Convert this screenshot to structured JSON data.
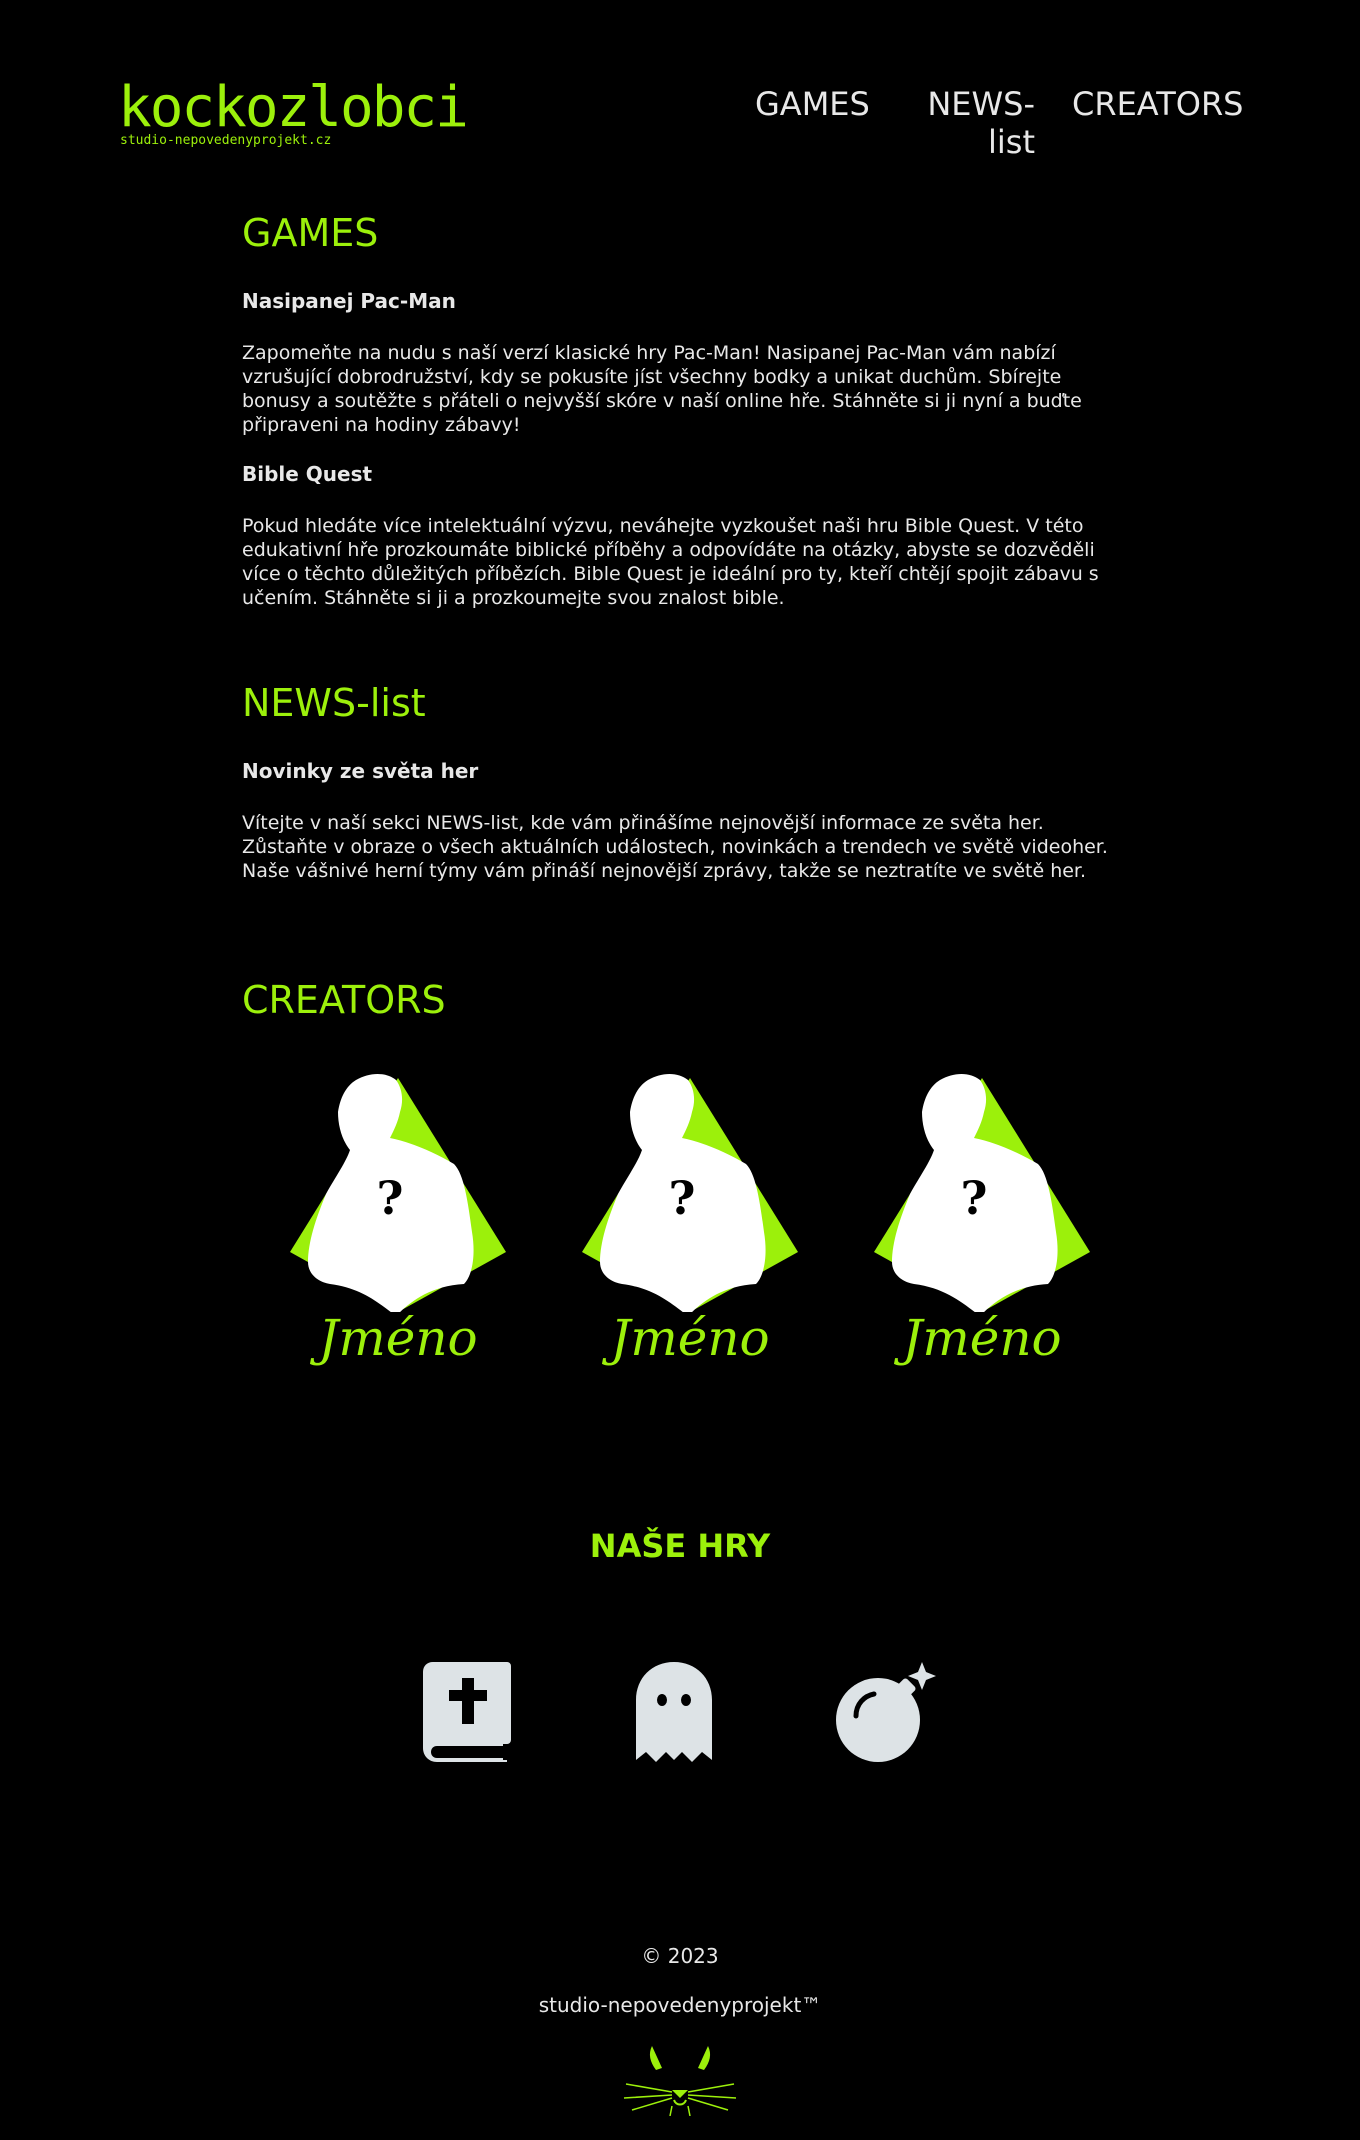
{
  "header": {
    "logo_text": "kockozlobci",
    "logo_subtext": "studio-nepovedenyprojekt.cz",
    "nav": {
      "games": "GAMES",
      "news": "NEWS-list",
      "creators": "CREATORS"
    }
  },
  "games": {
    "title": "GAMES",
    "items": [
      {
        "title": "Nasipanej Pac-Man",
        "text": "Zapomeňte na nudu s naší verzí klasické hry Pac-Man! Nasipanej Pac-Man vám nabízí vzrušující dobrodružství, kdy se pokusíte jíst všechny bodky a unikat duchům. Sbírejte bonusy a soutěžte s přáteli o nejvyšší skóre v naší online hře. Stáhněte si ji nyní a buďte připraveni na hodiny zábavy!"
      },
      {
        "title": "Bible Quest",
        "text": "Pokud hledáte více intelektuální výzvu, neváhejte vyzkoušet naši hru Bible Quest. V této edukativní hře prozkoumáte biblické příběhy a odpovídáte na otázky, abyste se dozvěděli více o těchto důležitých příbězích. Bible Quest je ideální pro ty, kteří chtějí spojit zábavu s učením. Stáhněte si ji a prozkoumejte svou znalost bible."
      }
    ]
  },
  "news": {
    "title": "NEWS-list",
    "items": [
      {
        "title": "Novinky ze světa her",
        "text": "Vítejte v naší sekci NEWS-list, kde vám přinášíme nejnovější informace ze světa her. Zůstaňte v obraze o všech aktuálních událostech, novinkách a trendech ve světě videoher. Naše vášnivé herní týmy vám přináší nejnovější zprávy, takže se neztratíte ve světě her."
      }
    ]
  },
  "creators": {
    "title": "CREATORS",
    "members": [
      {
        "name": "Jméno",
        "mark": "?"
      },
      {
        "name": "Jméno",
        "mark": "?"
      },
      {
        "name": "Jméno",
        "mark": "?"
      }
    ]
  },
  "our_games": {
    "title": "NAŠE HRY",
    "icons": [
      "bible-icon",
      "ghost-icon",
      "bomb-icon"
    ]
  },
  "footer": {
    "copyright": "© 2023",
    "studio": "studio-nepovedenyprojekt™"
  },
  "colors": {
    "accent": "#9cf00b",
    "background": "#000000",
    "text": "#e8e8e8",
    "icon": "#dde3e6"
  }
}
